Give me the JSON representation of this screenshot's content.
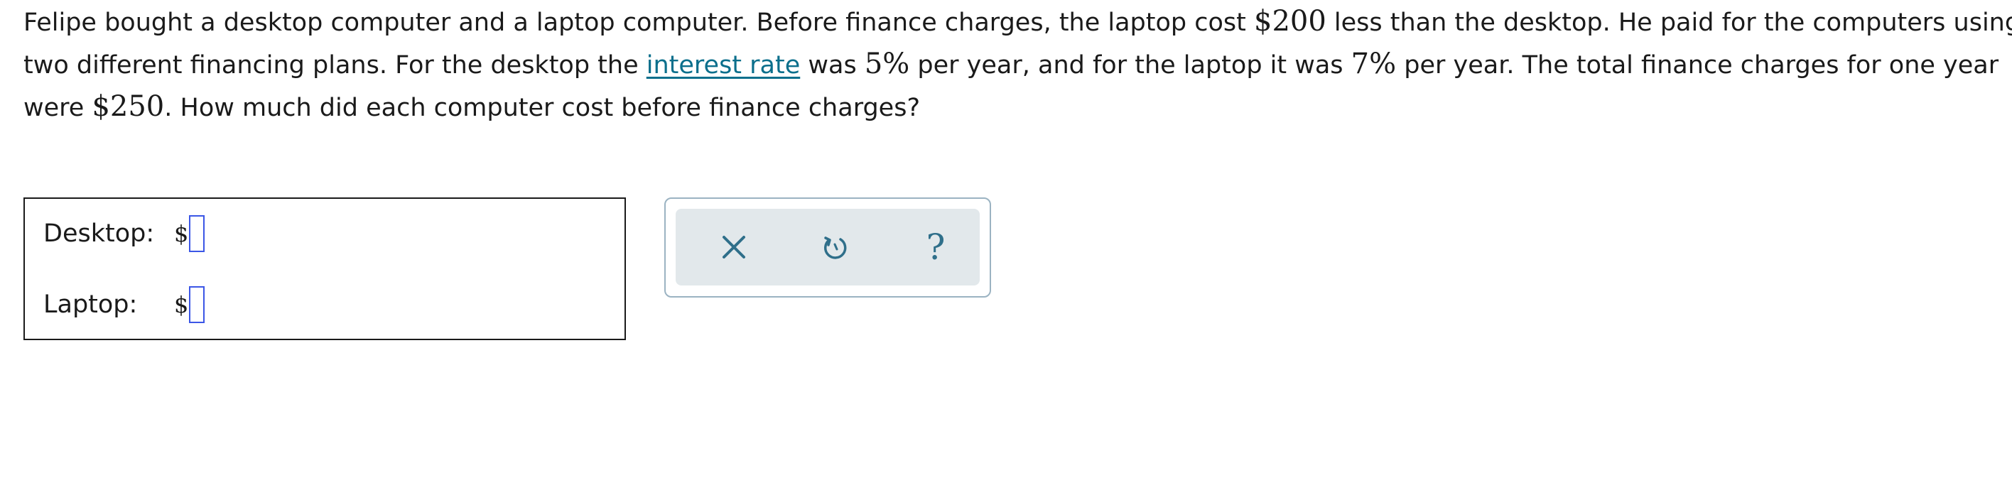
{
  "question": {
    "line1": {
      "before_amount": "Felipe bought a desktop computer and a laptop computer. Before finance charges, the laptop cost ",
      "amount": "$200",
      "after_amount": " less than the desktop. He paid for the computers using"
    },
    "line2": {
      "before_link": "two different financing plans. For the desktop the ",
      "link_text": "interest rate",
      "after_link": " was ",
      "desktop_rate": "5%",
      "middle": " per year, and for the laptop it was ",
      "laptop_rate": "7%",
      "after_rate": " per year. The total finance charges for one year"
    },
    "line3": {
      "before_total": "were ",
      "total": "$250",
      "after_total": ". How much did each computer cost before finance charges?"
    }
  },
  "answer": {
    "desktop_label": "Desktop:",
    "laptop_label": "Laptop:",
    "currency_symbol": "$",
    "desktop_value": "",
    "laptop_value": ""
  },
  "toolbar": {
    "clear_icon": "close-icon",
    "undo_icon": "undo-icon",
    "help_icon": "help-icon",
    "help_glyph": "?",
    "icon_color": "#2f6f8a"
  },
  "colors": {
    "link": "#0b6f8c",
    "input_border": "#3b56e6",
    "toolbar_bg": "#e2e8eb",
    "toolbar_border": "#9bb3c2"
  }
}
